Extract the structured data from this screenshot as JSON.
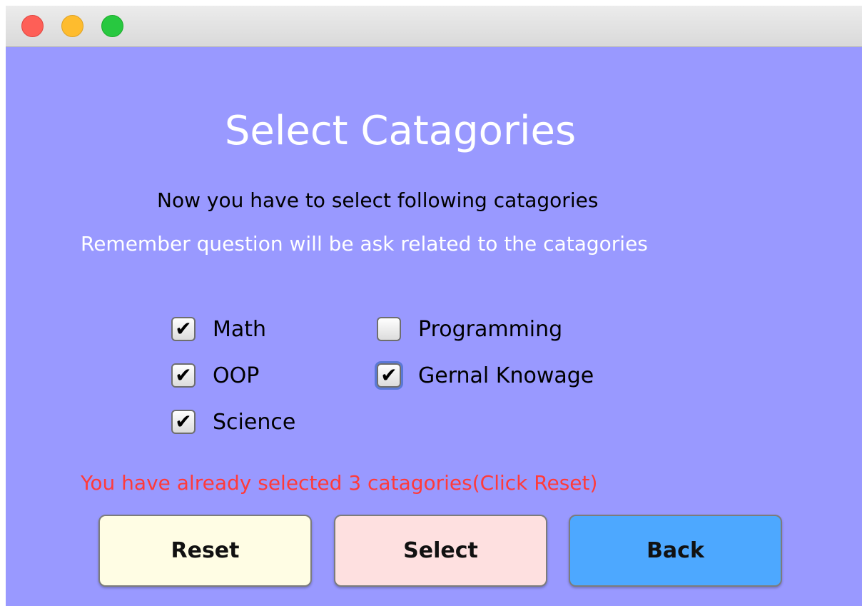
{
  "window": {
    "traffic_lights": [
      "close",
      "minimize",
      "maximize"
    ]
  },
  "page": {
    "title": "Select Catagories",
    "subtitle": "Now you have to select following catagories",
    "note": "Remember question will be ask related to the catagories"
  },
  "categories": [
    {
      "label": "Math",
      "checked": true
    },
    {
      "label": "OOP",
      "checked": true
    },
    {
      "label": "Science",
      "checked": true
    },
    {
      "label": "Programming",
      "checked": false
    },
    {
      "label": "Gernal Knowage",
      "checked": true
    }
  ],
  "status_message": "You have already selected 3 catagories(Click Reset)",
  "buttons": {
    "reset": "Reset",
    "select": "Select",
    "back": "Back"
  },
  "colors": {
    "background": "#9999ff",
    "status_text": "#ff3a3a",
    "reset_button": "#fffde4",
    "select_button": "#fee0e0",
    "back_button": "#4da8ff"
  }
}
